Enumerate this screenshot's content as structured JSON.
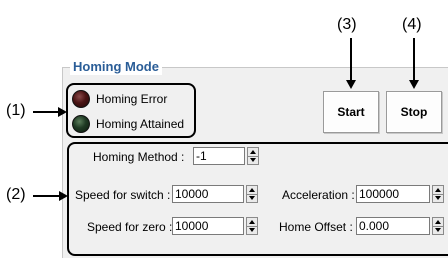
{
  "callouts": {
    "c1": "(1)",
    "c2": "(2)",
    "c3": "(3)",
    "c4": "(4)"
  },
  "group": {
    "title": "Homing Mode"
  },
  "status": {
    "error_label": "Homing Error",
    "attained_label": "Homing Attained"
  },
  "buttons": {
    "start": "Start",
    "stop": "Stop"
  },
  "params": {
    "method_label": "Homing Method :",
    "method_value": "-1",
    "speed_switch_label": "Speed for switch :",
    "speed_switch_value": "10000",
    "acceleration_label": "Acceleration :",
    "acceleration_value": "100000",
    "speed_zero_label": "Speed for zero :",
    "speed_zero_value": "10000",
    "home_offset_label": "Home Offset :",
    "home_offset_value": "0.000"
  },
  "colors": {
    "group_title": "#2a5d97",
    "panel_bg": "#f0f0f0"
  }
}
